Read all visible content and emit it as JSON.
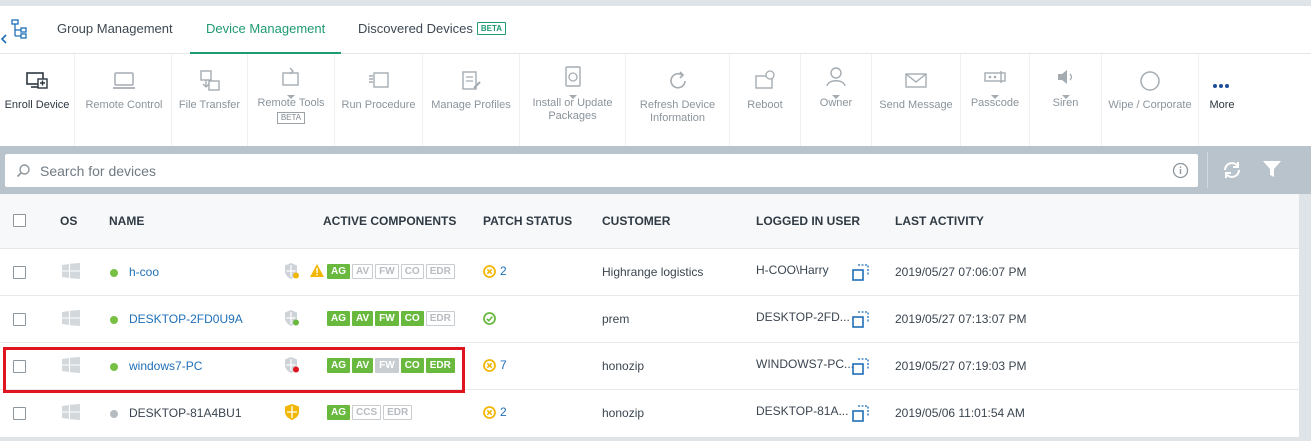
{
  "tabs": {
    "items": [
      {
        "label": "Group Management"
      },
      {
        "label": "Device Management"
      },
      {
        "label": "Discovered Devices",
        "badge": "BETA"
      }
    ],
    "active": "Device Management"
  },
  "toolbar": {
    "items": [
      {
        "label": "Enroll Device",
        "icon": "enroll-icon"
      },
      {
        "label": "Remote Control",
        "icon": "monitor-icon"
      },
      {
        "label": "File Transfer",
        "icon": "file-transfer-icon"
      },
      {
        "label": "Remote Tools",
        "icon": "remote-tools-icon",
        "badge": "BETA"
      },
      {
        "label": "Run Procedure",
        "icon": "run-procedure-icon"
      },
      {
        "label": "Manage Profiles",
        "icon": "profiles-icon"
      },
      {
        "label": "Install or Update Packages",
        "icon": "package-icon"
      },
      {
        "label": "Refresh Device Information",
        "icon": "refresh-icon"
      },
      {
        "label": "Reboot",
        "icon": "reboot-icon"
      },
      {
        "label": "Owner",
        "icon": "owner-icon"
      },
      {
        "label": "Send Message",
        "icon": "envelope-icon"
      },
      {
        "label": "Passcode",
        "icon": "passcode-icon"
      },
      {
        "label": "Siren",
        "icon": "speaker-icon"
      },
      {
        "label": "Wipe / Corporate",
        "icon": "circle-icon"
      },
      {
        "label": "More",
        "icon": "more-dots-icon"
      }
    ]
  },
  "search": {
    "placeholder": "Search for devices"
  },
  "table": {
    "columns": [
      "OS",
      "NAME",
      "ACTIVE COMPONENTS",
      "PATCH STATUS",
      "CUSTOMER",
      "LOGGED IN USER",
      "LAST ACTIVITY"
    ],
    "rows": [
      {
        "name": "h-coo",
        "status_color": "#78c043",
        "components": [
          "AG",
          "AV",
          "FW",
          "CO",
          "EDR"
        ],
        "active": [
          true,
          false,
          false,
          false,
          false
        ],
        "patch": "2",
        "patch_state": "warning",
        "customer": "Highrange logistics",
        "user": "H-COO\\Harry",
        "last_activity": "2019/05/27 07:06:07 PM"
      },
      {
        "name": "DESKTOP-2FD0U9A",
        "status_color": "#78c043",
        "components": [
          "AG",
          "AV",
          "FW",
          "CO",
          "EDR"
        ],
        "active": [
          true,
          true,
          true,
          true,
          false
        ],
        "patch": "",
        "patch_state": "ok",
        "customer": "prem",
        "user": "DESKTOP-2FD...",
        "last_activity": "2019/05/27 07:13:07 PM"
      },
      {
        "name": "windows7-PC",
        "status_color": "#78c043",
        "components": [
          "AG",
          "AV",
          "FW",
          "CO",
          "EDR"
        ],
        "active": [
          true,
          true,
          false,
          true,
          true
        ],
        "patch": "7",
        "patch_state": "warning",
        "customer": "honozip",
        "user": "WINDOWS7-PC...",
        "last_activity": "2019/05/27 07:19:03 PM"
      },
      {
        "name": "DESKTOP-81A4BU1",
        "status_color": "#b5bbc0",
        "components": [
          "AG",
          "CCS",
          "EDR"
        ],
        "active": [
          true,
          false,
          false
        ],
        "patch": "2",
        "patch_state": "warning",
        "customer": "honozip",
        "user": "DESKTOP-81A...",
        "last_activity": "2019/05/06 11:01:54 AM"
      }
    ]
  }
}
